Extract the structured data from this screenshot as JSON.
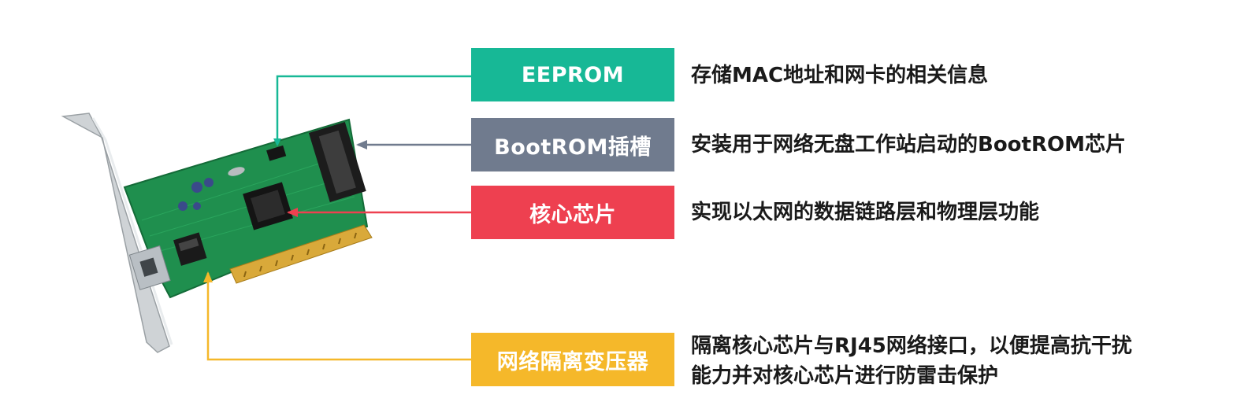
{
  "components": [
    {
      "id": "eeprom",
      "label": "EEPROM",
      "description": [
        "存储MAC地址和网卡的相关信息"
      ],
      "color": "#17b896"
    },
    {
      "id": "bootrom",
      "label": "BootROM插槽",
      "description": [
        "安装用于网络无盘工作站启动的BootROM芯片"
      ],
      "color": "#707b8e"
    },
    {
      "id": "core-chip",
      "label": "核心芯片",
      "description": [
        "实现以太网的数据链路层和物理层功能"
      ],
      "color": "#ee4050"
    },
    {
      "id": "transformer",
      "label": "网络隔离变压器",
      "description": [
        "隔离核心芯片与RJ45网络接口，以便提高抗干扰",
        "能力并对核心芯片进行防雷击保护"
      ],
      "color": "#f5b82a"
    }
  ]
}
